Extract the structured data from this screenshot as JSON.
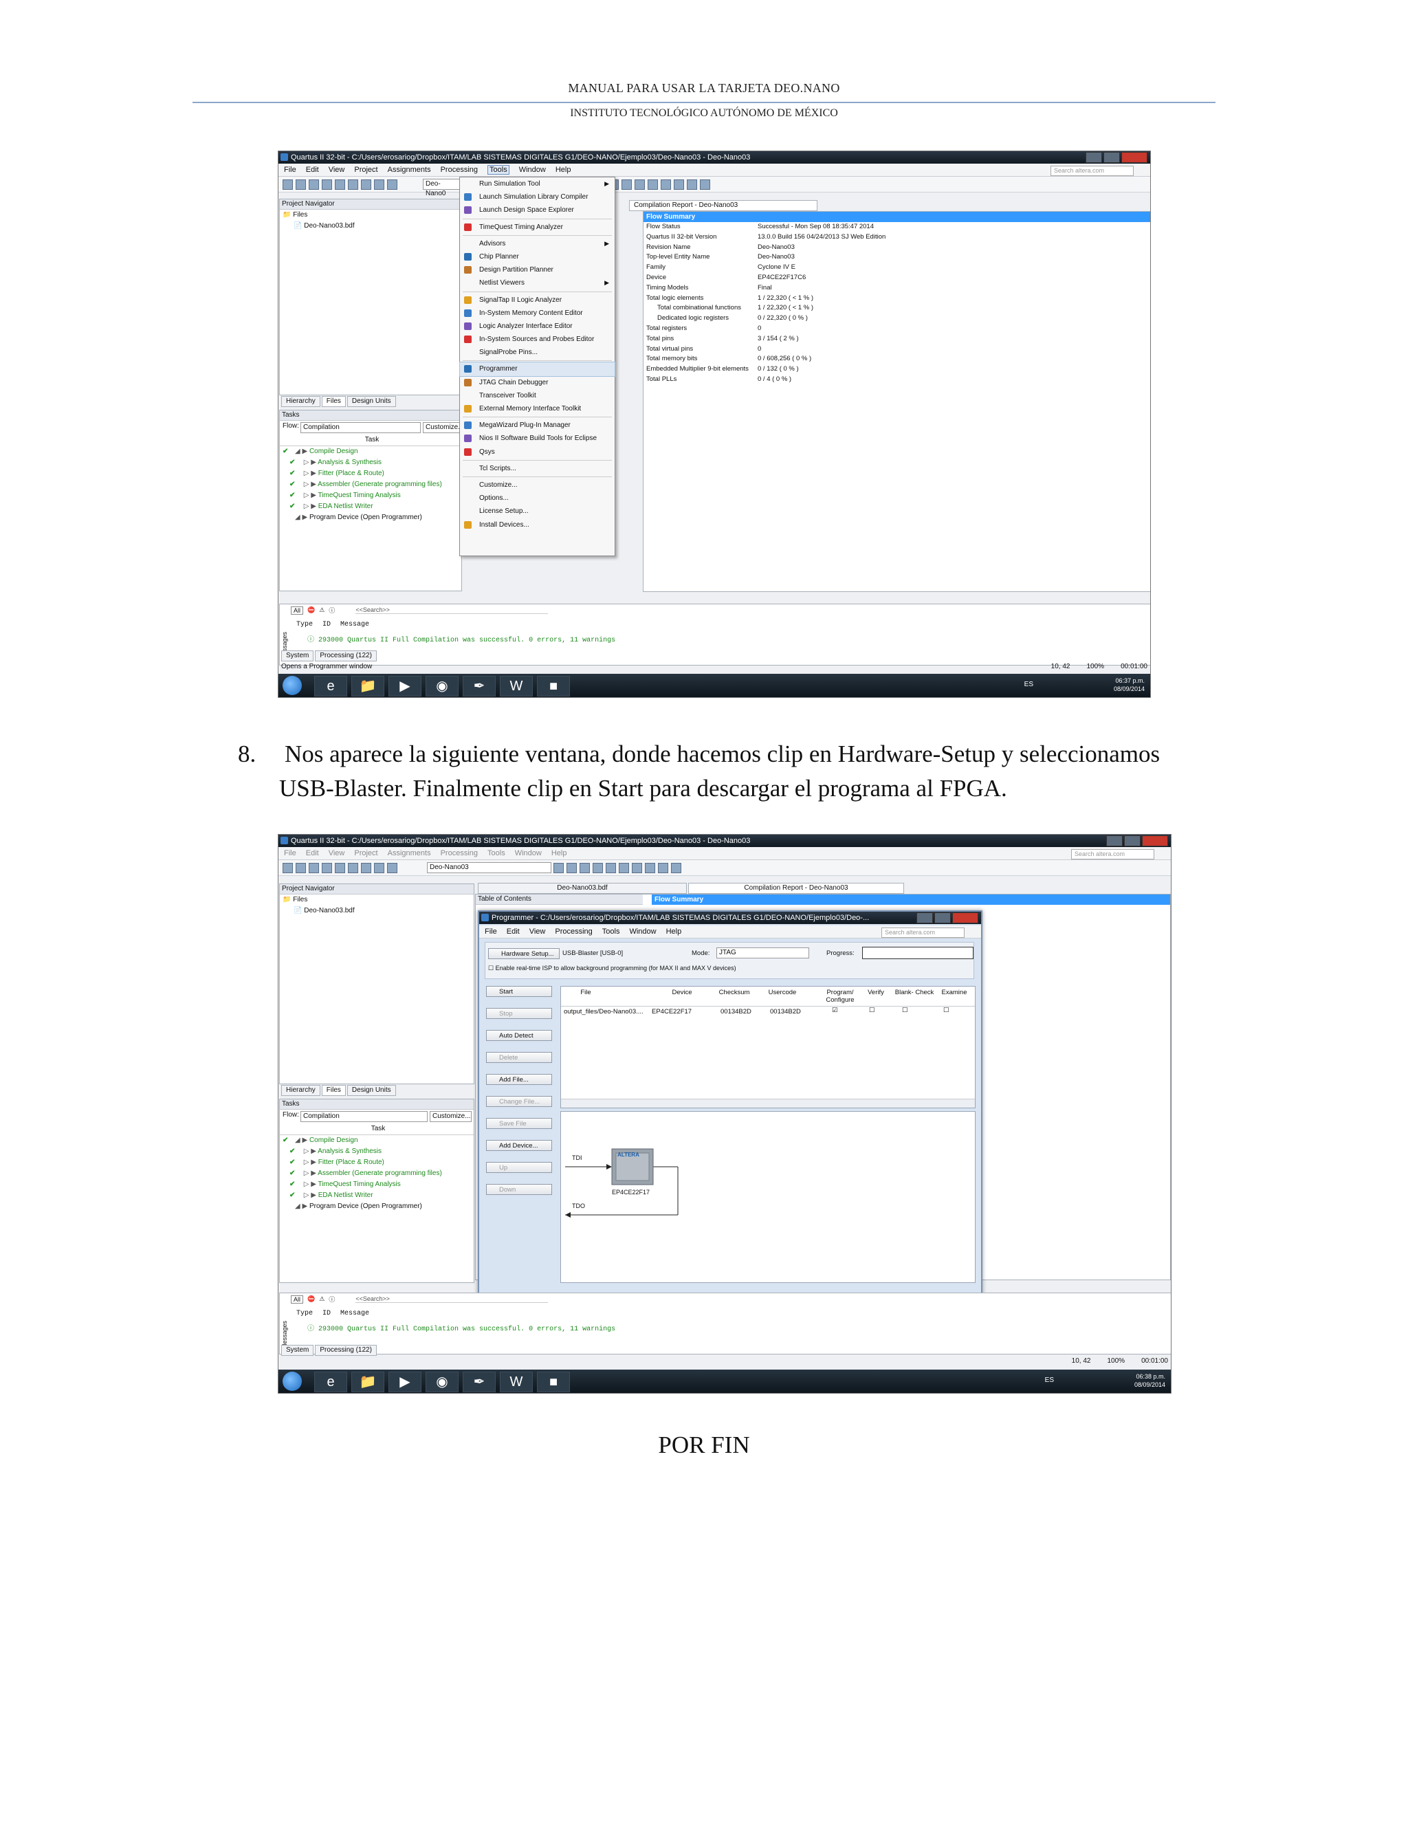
{
  "doc": {
    "header_title": "MANUAL PARA USAR LA TARJETA DEO.NANO",
    "header_subtitle": "INSTITUTO TECNOLÓGICO AUTÓNOMO DE MÉXICO",
    "step_number": "8.",
    "step_line1": "Nos aparece la siguiente ventana, donde hacemos clip en Hardware-Setup y seleccionamos",
    "step_line2": "USB-Blaster. Finalmente clip en Start para  descargar el programa al FPGA.",
    "closing": "POR  FIN"
  },
  "shot1": {
    "title": "Quartus II 32-bit - C:/Users/erosariog/Dropbox/ITAM/LAB SISTEMAS DIGITALES G1/DEO-NANO/Ejemplo03/Deo-Nano03 - Deo-Nano03",
    "menu": [
      "File",
      "Edit",
      "View",
      "Project",
      "Assignments",
      "Processing",
      "Tools",
      "Window",
      "Help"
    ],
    "search_placeholder": "Search altera.com",
    "combo": "Deo-Nano0",
    "project_navigator": "Project Navigator",
    "files_folder": "Files",
    "file": "Deo-Nano03.bdf",
    "nav_tabs": [
      "Hierarchy",
      "Files",
      "Design Units"
    ],
    "tasks_label": "Tasks",
    "flow_label": "Flow:",
    "flow_value": "Compilation",
    "customize": "Customize...",
    "task_header": "Task",
    "tasks": [
      {
        "label": "Compile Design",
        "indent": 0
      },
      {
        "label": "Analysis & Synthesis",
        "indent": 1
      },
      {
        "label": "Fitter (Place & Route)",
        "indent": 1
      },
      {
        "label": "Assembler (Generate programming files)",
        "indent": 1
      },
      {
        "label": "TimeQuest Timing Analysis",
        "indent": 1
      },
      {
        "label": "EDA Netlist Writer",
        "indent": 1
      },
      {
        "label": "Program Device (Open Programmer)",
        "indent": 0
      }
    ],
    "tools_menu": [
      {
        "label": "Run Simulation Tool",
        "sub": true
      },
      {
        "label": "Launch Simulation Library Compiler"
      },
      {
        "label": "Launch Design Space Explorer"
      },
      {
        "label": "TimeQuest Timing Analyzer"
      },
      {
        "label": "Advisors",
        "sub": true
      },
      {
        "label": "Chip Planner"
      },
      {
        "label": "Design Partition Planner"
      },
      {
        "label": "Netlist Viewers",
        "sub": true
      },
      {
        "label": "SignalTap II Logic Analyzer"
      },
      {
        "label": "In-System Memory Content Editor"
      },
      {
        "label": "Logic Analyzer Interface Editor"
      },
      {
        "label": "In-System Sources and Probes Editor"
      },
      {
        "label": "SignalProbe Pins..."
      },
      {
        "label": "Programmer",
        "highlight": true
      },
      {
        "label": "JTAG Chain Debugger"
      },
      {
        "label": "Transceiver Toolkit"
      },
      {
        "label": "External Memory Interface Toolkit"
      },
      {
        "label": "MegaWizard Plug-In Manager"
      },
      {
        "label": "Nios II Software Build Tools for Eclipse"
      },
      {
        "label": "Qsys"
      },
      {
        "label": "Tcl Scripts..."
      },
      {
        "label": "Customize..."
      },
      {
        "label": "Options..."
      },
      {
        "label": "License Setup..."
      },
      {
        "label": "Install Devices..."
      }
    ],
    "report_tab": "Compilation Report - Deo-Nano03",
    "flow_summary_title": "Flow Summary",
    "flow_summary": [
      {
        "k": "Flow Status",
        "v": "Successful - Mon Sep 08 18:35:47 2014"
      },
      {
        "k": "Quartus II 32-bit Version",
        "v": "13.0.0 Build 156 04/24/2013 SJ Web Edition"
      },
      {
        "k": "Revision Name",
        "v": "Deo-Nano03"
      },
      {
        "k": "Top-level Entity Name",
        "v": "Deo-Nano03"
      },
      {
        "k": "Family",
        "v": "Cyclone IV E"
      },
      {
        "k": "Device",
        "v": "EP4CE22F17C6"
      },
      {
        "k": "Timing Models",
        "v": "Final"
      },
      {
        "k": "Total logic elements",
        "v": "1 / 22,320 ( < 1 % )"
      },
      {
        "k": "Total combinational functions",
        "v": "1 / 22,320 ( < 1 % )",
        "ind": true
      },
      {
        "k": "Dedicated logic registers",
        "v": "0 / 22,320 ( 0 % )",
        "ind": true
      },
      {
        "k": "Total registers",
        "v": "0"
      },
      {
        "k": "Total pins",
        "v": "3 / 154 ( 2 % )"
      },
      {
        "k": "Total virtual pins",
        "v": "0"
      },
      {
        "k": "Total memory bits",
        "v": "0 / 608,256 ( 0 % )"
      },
      {
        "k": "Embedded Multiplier 9-bit elements",
        "v": "0 / 132 ( 0 % )"
      },
      {
        "k": "Total PLLs",
        "v": "0 / 4 ( 0 % )"
      }
    ],
    "msg_all": "All",
    "msg_search": "<<Search>>",
    "msg_headers": [
      "Type",
      "ID",
      "Message"
    ],
    "msg_text": "293000 Quartus II Full Compilation was successful. 0 errors, 11 warnings",
    "msg_side": "Messages",
    "msg_tabs": [
      "System",
      "Processing (122)"
    ],
    "status_left": "Opens a Programmer window",
    "status_right": [
      "10, 42",
      "100%",
      "00:01:00"
    ],
    "lang": "ES",
    "time": "06:37 p.m.",
    "date": "08/09/2014"
  },
  "shot2": {
    "title": "Quartus II 32-bit - C:/Users/erosariog/Dropbox/ITAM/LAB SISTEMAS DIGITALES G1/DEO-NANO/Ejemplo03/Deo-Nano03 - Deo-Nano03",
    "menu": [
      "File",
      "Edit",
      "View",
      "Project",
      "Assignments",
      "Processing",
      "Tools",
      "Window",
      "Help"
    ],
    "search_placeholder": "Search altera.com",
    "combo": "Deo-Nano03",
    "bdf_tab": "Deo-Nano03.bdf",
    "report_tab": "Compilation Report - Deo-Nano03",
    "toc": "Table of Contents",
    "flow_summary_title": "Flow Summary",
    "project_navigator": "Project Navigator",
    "files_folder": "Files",
    "file": "Deo-Nano03.bdf",
    "nav_tabs": [
      "Hierarchy",
      "Files",
      "Design Units"
    ],
    "tasks_label": "Tasks",
    "flow_label": "Flow:",
    "flow_value": "Compilation",
    "customize": "Customize...",
    "task_header": "Task",
    "tasks": [
      {
        "label": "Compile Design",
        "indent": 0
      },
      {
        "label": "Analysis & Synthesis",
        "indent": 1
      },
      {
        "label": "Fitter (Place & Route)",
        "indent": 1
      },
      {
        "label": "Assembler (Generate programming files)",
        "indent": 1
      },
      {
        "label": "TimeQuest Timing Analysis",
        "indent": 1
      },
      {
        "label": "EDA Netlist Writer",
        "indent": 1
      },
      {
        "label": "Program Device (Open Programmer)",
        "indent": 0
      }
    ],
    "programmer": {
      "title": "Programmer - C:/Users/erosariog/Dropbox/ITAM/LAB SISTEMAS DIGITALES G1/DEO-NANO/Ejemplo03/Deo-...",
      "menu": [
        "File",
        "Edit",
        "View",
        "Processing",
        "Tools",
        "Window",
        "Help"
      ],
      "search_placeholder": "Search altera.com",
      "hardware_setup": "Hardware Setup...",
      "hardware": "USB-Blaster [USB-0]",
      "mode_label": "Mode:",
      "mode": "JTAG",
      "progress_label": "Progress:",
      "realtime_isp": "Enable real-time ISP to allow background programming (for MAX II and MAX V devices)",
      "buttons": [
        {
          "label": "Start",
          "enabled": true
        },
        {
          "label": "Stop",
          "enabled": false
        },
        {
          "label": "Auto Detect",
          "enabled": true
        },
        {
          "label": "Delete",
          "enabled": false
        },
        {
          "label": "Add File...",
          "enabled": true
        },
        {
          "label": "Change File...",
          "enabled": false
        },
        {
          "label": "Save File",
          "enabled": false
        },
        {
          "label": "Add Device...",
          "enabled": true
        },
        {
          "label": "Up",
          "enabled": false
        },
        {
          "label": "Down",
          "enabled": false
        }
      ],
      "columns": [
        "File",
        "Device",
        "Checksum",
        "Usercode",
        "Program/ Configure",
        "Verify",
        "Blank- Check",
        "Examine"
      ],
      "row": {
        "file": "output_files/Deo-Nano03....",
        "device": "EP4CE22F17",
        "checksum": "00134B2D",
        "usercode": "00134B2D"
      },
      "tdi": "TDI",
      "tdo": "TDO",
      "chip_logo": "ALTERA",
      "chip_name": "EP4CE22F17"
    },
    "msg_all": "All",
    "msg_search": "<<Search>>",
    "msg_headers": [
      "Type",
      "ID",
      "Message"
    ],
    "msg_text": "293000 Quartus II Full Compilation was successful. 0 errors, 11 warnings",
    "msg_side": "Messages",
    "msg_tabs": [
      "System",
      "Processing (122)"
    ],
    "status_right": [
      "10, 42",
      "100%",
      "00:01:00"
    ],
    "lang": "ES",
    "time": "06:38 p.m.",
    "date": "08/09/2014"
  }
}
